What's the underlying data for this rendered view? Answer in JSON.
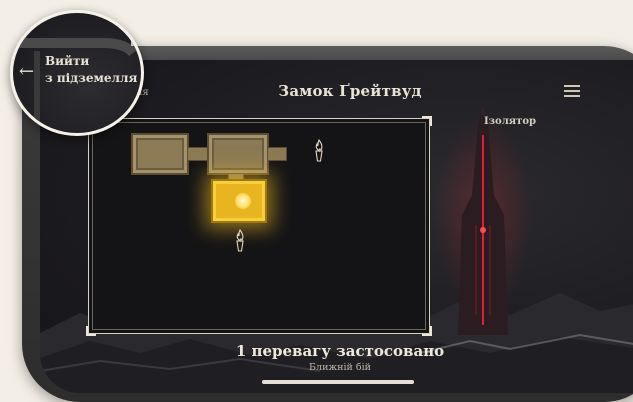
{
  "header": {
    "title": "Замок Ґрейтвуд",
    "exit_partial": "емелля",
    "menu_icon": "hamburger-icon"
  },
  "exit_zoom": {
    "line1": "Вийти",
    "line2": "з підземелля",
    "arrow": "←"
  },
  "tower": {
    "label": "Ізолятор"
  },
  "footer": {
    "status": "1 перевагу застосовано",
    "category": "Ближній бій"
  },
  "colors": {
    "background": "#f3eee6",
    "screen": "#1d1c20",
    "room": "#8c7a55",
    "room_active": "#e8b520",
    "text": "#efe9dc"
  }
}
